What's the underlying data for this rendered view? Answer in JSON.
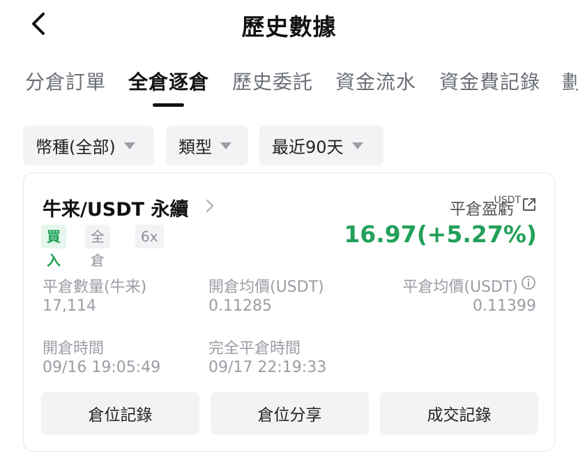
{
  "header": {
    "title": "歷史數據"
  },
  "tabs": [
    {
      "label": "分倉訂單"
    },
    {
      "label": "全倉逐倉"
    },
    {
      "label": "歷史委託"
    },
    {
      "label": "資金流水"
    },
    {
      "label": "資金費記錄"
    },
    {
      "label": "劃"
    }
  ],
  "filters": [
    {
      "label": "幣種(全部)"
    },
    {
      "label": "類型"
    },
    {
      "label": "最近90天"
    }
  ],
  "position": {
    "pair": "牛来/USDT 永續",
    "badges": {
      "side": "買入",
      "margin_mode": "全倉",
      "leverage": "6x"
    },
    "pnl_label": "平倉盈虧",
    "pnl_unit": "USDT",
    "pnl_value": "16.97(+5.27%)",
    "fields": {
      "close_qty_label": "平倉數量(牛来)",
      "close_qty_value": "17,114",
      "open_avg_label": "開倉均價(USDT)",
      "open_avg_value": "0.11285",
      "close_avg_label": "平倉均價(USDT)",
      "close_avg_value": "0.11399",
      "open_time_label": "開倉時間",
      "open_time_value": "09/16 19:05:49",
      "full_close_time_label": "完全平倉時間",
      "full_close_time_value": "09/17 22:19:33"
    },
    "buttons": {
      "records": "倉位記錄",
      "share": "倉位分享",
      "trades": "成交記錄"
    }
  },
  "colors": {
    "profit": "#22a05a",
    "buy_badge_bg": "#e5f6ec",
    "buy_badge_text": "#1ca255",
    "muted": "#9a9da4"
  }
}
